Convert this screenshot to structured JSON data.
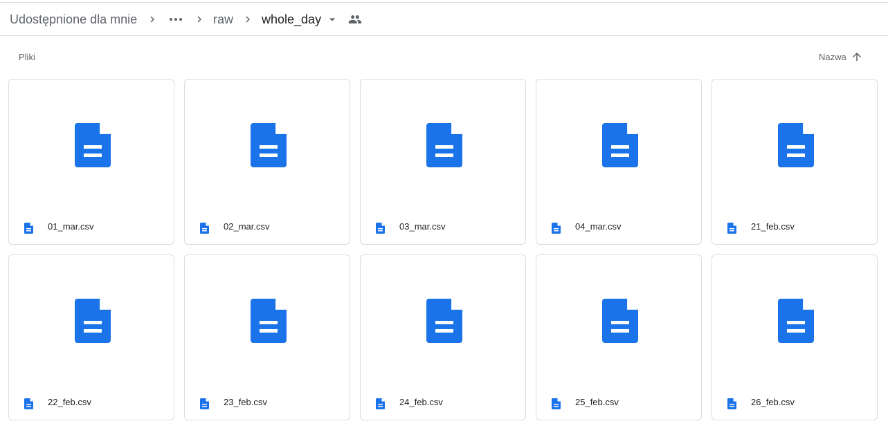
{
  "breadcrumb": {
    "root": "Udostępnione dla mnie",
    "more": "•••",
    "parent": "raw",
    "current": "whole_day"
  },
  "section": {
    "label": "Pliki"
  },
  "sort": {
    "label": "Nazwa",
    "direction": "ascending"
  },
  "colors": {
    "doc_blue": "#1a73e8",
    "border": "#dadce0",
    "muted_text": "#5f6368"
  },
  "files": [
    {
      "name": "01_mar.csv",
      "icon": "google-docs-icon"
    },
    {
      "name": "02_mar.csv",
      "icon": "google-docs-icon"
    },
    {
      "name": "03_mar.csv",
      "icon": "google-docs-icon"
    },
    {
      "name": "04_mar.csv",
      "icon": "google-docs-icon"
    },
    {
      "name": "21_feb.csv",
      "icon": "google-docs-icon"
    },
    {
      "name": "22_feb.csv",
      "icon": "google-docs-icon"
    },
    {
      "name": "23_feb.csv",
      "icon": "google-docs-icon"
    },
    {
      "name": "24_feb.csv",
      "icon": "google-docs-icon"
    },
    {
      "name": "25_feb.csv",
      "icon": "google-docs-icon"
    },
    {
      "name": "26_feb.csv",
      "icon": "google-docs-icon"
    }
  ]
}
